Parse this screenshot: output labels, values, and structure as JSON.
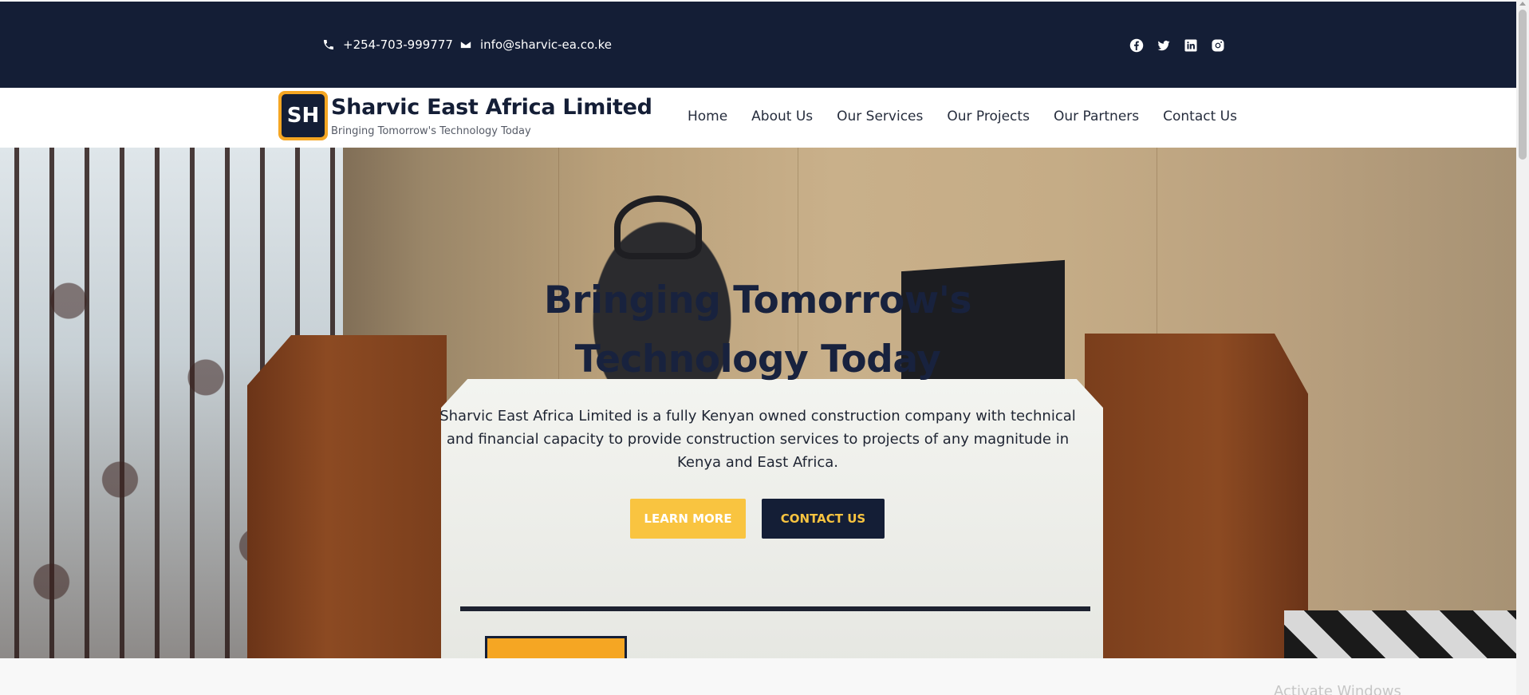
{
  "topbar": {
    "phone": "+254-703-999777",
    "email": "info@sharvic-ea.co.ke",
    "socials": [
      "facebook-icon",
      "twitter-icon",
      "linkedin-icon",
      "instagram-icon"
    ]
  },
  "header": {
    "logo_text": "SH",
    "brand_name": "Sharvic East Africa Limited",
    "tagline": "Bringing Tomorrow's Technology Today",
    "nav": [
      "Home",
      "About Us",
      "Our Services",
      "Our Projects",
      "Our Partners",
      "Contact Us"
    ]
  },
  "hero": {
    "title_line1": "Bringing Tomorrow's",
    "title_line2": "Technology Today",
    "description": "Sharvic East Africa Limited is a fully Kenyan owned construction company with technical and financial capacity to provide construction services to projects of any magnitude in Kenya and East Africa.",
    "learn_more": "LEARN MORE",
    "contact_us": "CONTACT US"
  },
  "overlay": {
    "windows_watermark": "Activate Windows"
  },
  "colors": {
    "navy": "#141e36",
    "gold": "#f9c440"
  }
}
